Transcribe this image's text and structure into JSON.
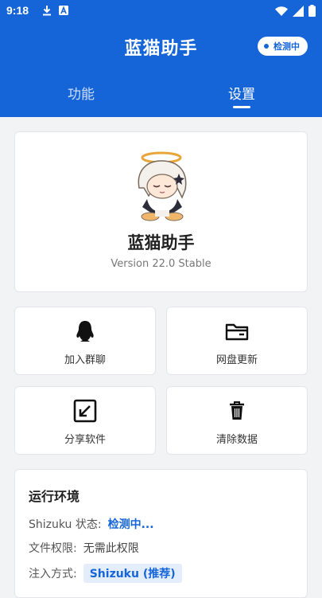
{
  "status_bar": {
    "time": "9:18",
    "left_icons": [
      "download-icon",
      "a-box-icon"
    ],
    "right_icons": [
      "wifi-icon",
      "signal-icon",
      "battery-icon"
    ]
  },
  "header": {
    "title": "蓝猫助手",
    "chip_label": "检测中",
    "background": "#1565d8"
  },
  "tabs": [
    {
      "label": "功能",
      "active": false
    },
    {
      "label": "设置",
      "active": true
    }
  ],
  "about": {
    "name": "蓝猫助手",
    "version": "Version 22.0 Stable"
  },
  "actions": [
    {
      "label": "加入群聊",
      "icon": "qq-penguin-icon"
    },
    {
      "label": "网盘更新",
      "icon": "folder-icon"
    },
    {
      "label": "分享软件",
      "icon": "share-arrow-icon"
    },
    {
      "label": "清除数据",
      "icon": "trash-icon"
    }
  ],
  "environment": {
    "title": "运行环境",
    "rows": [
      {
        "label": "Shizuku 状态:",
        "value": "检测中..."
      },
      {
        "label": "文件权限:",
        "value": "无需此权限"
      },
      {
        "label": "注入方式:",
        "value": "Shizuku (推荐)"
      }
    ]
  }
}
